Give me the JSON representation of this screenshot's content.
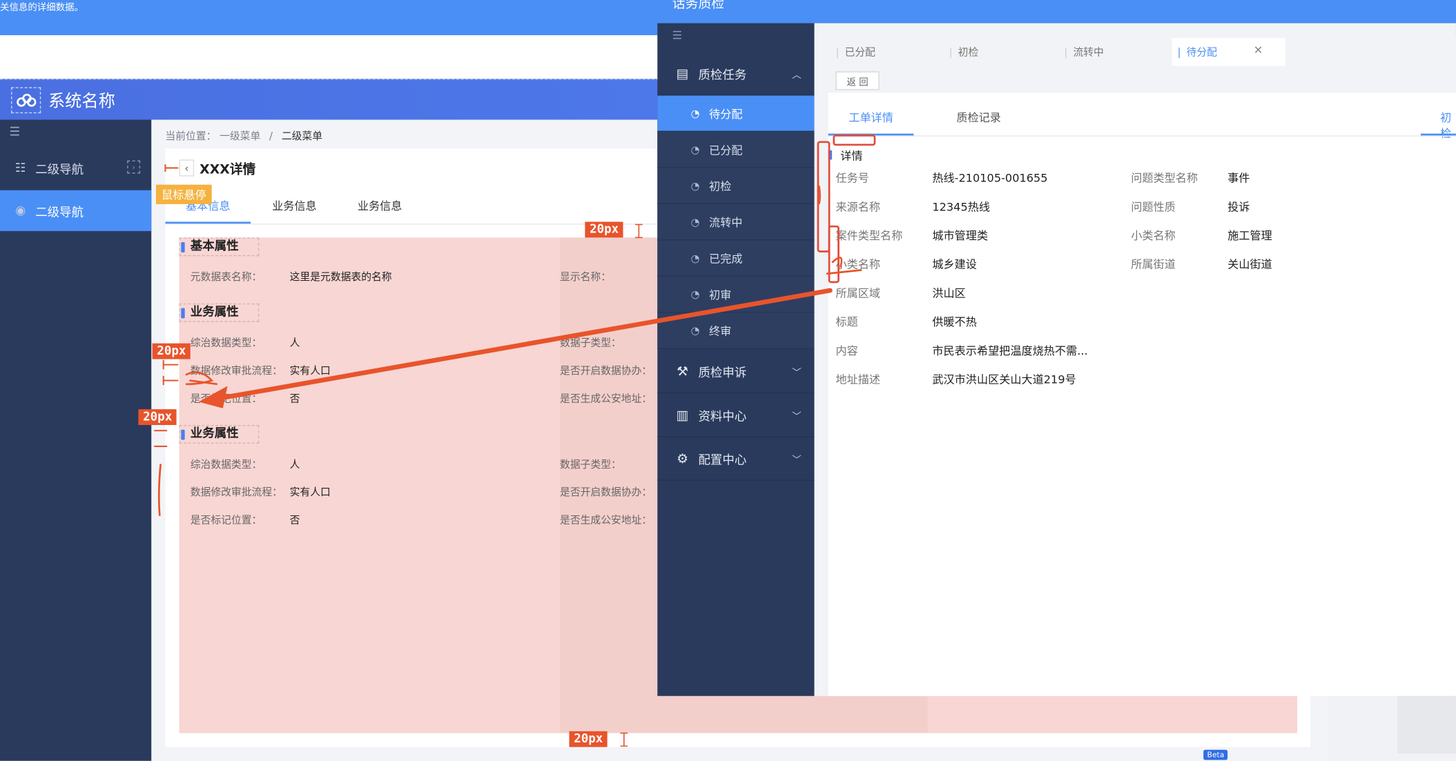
{
  "top_banner": {
    "text": "关信息的详细数据。"
  },
  "header": {
    "system_name": "系统名称"
  },
  "left_nav": {
    "items": [
      {
        "label": "二级导航",
        "active": false
      },
      {
        "label": "二级导航",
        "active": true
      }
    ]
  },
  "breadcrumb": {
    "prefix": "当前位置：",
    "level1": "一级菜单",
    "sep": "/",
    "level2": "二级菜单"
  },
  "page": {
    "title": "XXX详情",
    "hover_badge": "鼠标悬停"
  },
  "tabs": [
    {
      "label": "基本信息",
      "active": true
    },
    {
      "label": "业务信息",
      "active": false
    },
    {
      "label": "业务信息",
      "active": false
    }
  ],
  "sections": [
    {
      "title": "基本属性",
      "fields": [
        {
          "label": "元数据表名称：",
          "value": "这里是元数据表的名称"
        },
        {
          "label": "显示名称：",
          "value": ""
        }
      ]
    },
    {
      "title": "业务属性",
      "fields": [
        {
          "label": "综治数据类型：",
          "value": "人"
        },
        {
          "label": "数据子类型：",
          "value": ""
        },
        {
          "label": "数据修改审批流程：",
          "value": "实有人口"
        },
        {
          "label": "是否开启数据协办：",
          "value": ""
        },
        {
          "label": "是否标记位置：",
          "value": "否"
        },
        {
          "label": "是否生成公安地址：",
          "value": ""
        }
      ]
    },
    {
      "title": "业务属性",
      "fields": [
        {
          "label": "综治数据类型：",
          "value": "人"
        },
        {
          "label": "数据子类型：",
          "value": ""
        },
        {
          "label": "数据修改审批流程：",
          "value": "实有人口"
        },
        {
          "label": "是否开启数据协办：",
          "value": ""
        },
        {
          "label": "是否标记位置：",
          "value": "否"
        },
        {
          "label": "是否生成公安地址：",
          "value": ""
        }
      ]
    }
  ],
  "annotations": {
    "spacing": "20px"
  },
  "right_panel": {
    "title": "话务质检",
    "menu": {
      "group1": {
        "label": "质检任务"
      },
      "sub": [
        "待分配",
        "已分配",
        "初检",
        "流转中",
        "已完成",
        "初审",
        "终审"
      ],
      "group2": {
        "label": "质检申诉"
      },
      "group3": {
        "label": "资料中心"
      },
      "group4": {
        "label": "配置中心"
      }
    },
    "tabs": [
      "已分配",
      "初检",
      "流转中",
      "待分配"
    ],
    "return_label": "返 回",
    "work_tabs": [
      "工单详情",
      "质检记录",
      "初检"
    ],
    "detail_title": "详情",
    "details": {
      "task_no_label": "任务号",
      "task_no": "热线-210105-001655",
      "source_label": "来源名称",
      "source": "12345热线",
      "case_type_label": "案件类型名称",
      "case_type": "城市管理类",
      "subclass_label": "小类名称",
      "subclass": "城乡建设",
      "region_label": "所属区域",
      "region": "洪山区",
      "title_label": "标题",
      "title": "供暖不热",
      "content_label": "内容",
      "content": "市民表示希望把温度烧热不需...",
      "address_label": "地址描述",
      "address": "武汉市洪山区关山大道219号",
      "issue_type_label": "问题类型名称",
      "issue_type": "事件",
      "issue_nature_label": "问题性质",
      "issue_nature": "投诉",
      "sub_label": "小类名称",
      "sub_value": "施工管理",
      "street_label": "所属街道",
      "street": "关山街道"
    },
    "beta": "Beta"
  }
}
